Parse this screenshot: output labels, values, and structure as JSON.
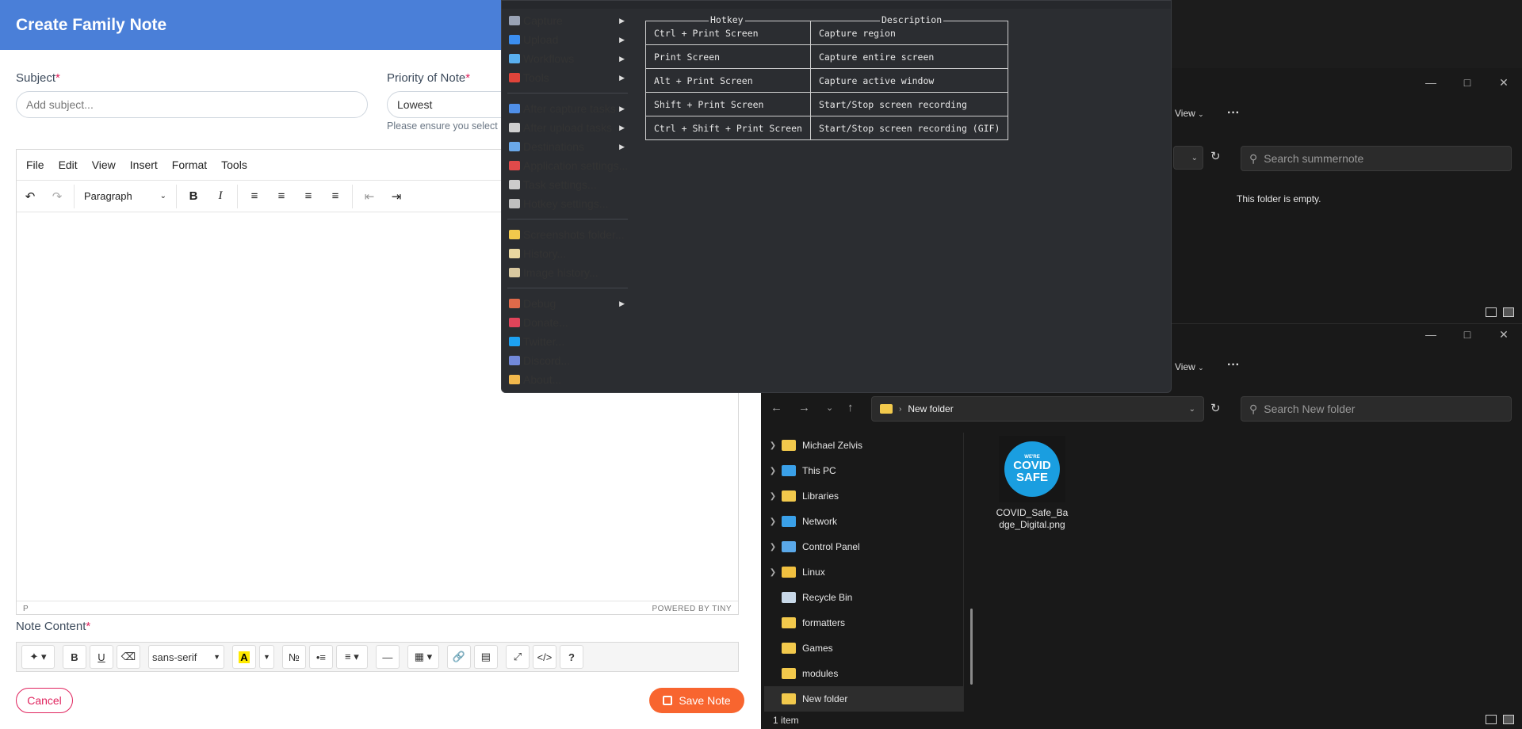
{
  "modal": {
    "title": "Create Family Note",
    "subject_label": "Subject",
    "subject_placeholder": "Add subject...",
    "priority_label": "Priority of Note",
    "priority_value": "Lowest",
    "priority_hint": "Please ensure you select",
    "required_mark": "*",
    "editor_menu": [
      "File",
      "Edit",
      "View",
      "Insert",
      "Format",
      "Tools"
    ],
    "block_format": "Paragraph",
    "status_path": "P",
    "powered_by": "POWERED BY TINY",
    "note_content_label": "Note Content",
    "font_name": "sans-serif",
    "cancel_label": "Cancel",
    "save_label": "Save Note"
  },
  "sharex": {
    "menu_items": [
      {
        "label": "Capture",
        "submenu": true,
        "color": "#9aa3b5"
      },
      {
        "label": "Upload",
        "submenu": true,
        "color": "#3b8ef0"
      },
      {
        "label": "Workflows",
        "submenu": true,
        "color": "#5ab0f0"
      },
      {
        "label": "Tools",
        "submenu": true,
        "color": "#e0443a"
      },
      {
        "label": "After capture tasks",
        "submenu": true,
        "color": "#4f8fe8",
        "sep_before": true
      },
      {
        "label": "After upload tasks",
        "submenu": true,
        "color": "#cfcfcf"
      },
      {
        "label": "Destinations",
        "submenu": true,
        "color": "#6aa8e8"
      },
      {
        "label": "Application settings...",
        "submenu": false,
        "color": "#e04a4a"
      },
      {
        "label": "Task settings...",
        "submenu": false,
        "color": "#cccccc"
      },
      {
        "label": "Hotkey settings...",
        "submenu": false,
        "color": "#bfbfbf"
      },
      {
        "label": "Screenshots folder...",
        "submenu": false,
        "color": "#f2c94c",
        "sep_before": true
      },
      {
        "label": "History...",
        "submenu": false,
        "color": "#e8d6a0"
      },
      {
        "label": "Image history...",
        "submenu": false,
        "color": "#d8c8a0"
      },
      {
        "label": "Debug",
        "submenu": true,
        "color": "#e06a4a",
        "sep_before": true
      },
      {
        "label": "Donate...",
        "submenu": false,
        "color": "#e0445a"
      },
      {
        "label": "Twitter...",
        "submenu": false,
        "color": "#1da1f2"
      },
      {
        "label": "Discord...",
        "submenu": false,
        "color": "#7289da"
      },
      {
        "label": "About...",
        "submenu": false,
        "color": "#f2b84c"
      }
    ],
    "hotkey_header": "Hotkey",
    "description_header": "Description",
    "hotkeys": [
      {
        "key": "Ctrl + Print Screen",
        "desc": "Capture region"
      },
      {
        "key": "Print Screen",
        "desc": "Capture entire screen"
      },
      {
        "key": "Alt + Print Screen",
        "desc": "Capture active window"
      },
      {
        "key": "Shift + Print Screen",
        "desc": "Start/Stop screen recording"
      },
      {
        "key": "Ctrl + Shift + Print Screen",
        "desc": "Start/Stop screen recording (GIF)"
      }
    ]
  },
  "explorer1": {
    "view_label": "View",
    "search_placeholder": "Search summernote",
    "empty_text": "This folder is empty."
  },
  "explorer2": {
    "view_label": "View",
    "breadcrumb": "New folder",
    "search_placeholder": "Search New folder",
    "tree": [
      {
        "label": "Michael Zelvis",
        "expandable": true,
        "icon": "folder-icon"
      },
      {
        "label": "This PC",
        "expandable": true,
        "icon": "pc-icon"
      },
      {
        "label": "Libraries",
        "expandable": true,
        "icon": "folder-icon"
      },
      {
        "label": "Network",
        "expandable": true,
        "icon": "network-icon"
      },
      {
        "label": "Control Panel",
        "expandable": true,
        "icon": "control-panel-icon"
      },
      {
        "label": "Linux",
        "expandable": true,
        "icon": "linux-icon"
      },
      {
        "label": "Recycle Bin",
        "expandable": false,
        "icon": "recycle-bin-icon"
      },
      {
        "label": "formatters",
        "expandable": false,
        "icon": "folder-icon"
      },
      {
        "label": "Games",
        "expandable": false,
        "icon": "folder-icon"
      },
      {
        "label": "modules",
        "expandable": false,
        "icon": "folder-icon"
      },
      {
        "label": "New folder",
        "expandable": false,
        "icon": "folder-icon",
        "selected": true
      }
    ],
    "file_name": "COVID_Safe_Badge_Digital.png",
    "badge_line1": "WE'RE",
    "badge_line2": "COVID",
    "badge_line3": "SAFE",
    "status": "1 item"
  },
  "colors": {
    "modal_header": "#4a7fd8",
    "save_button": "#f8652f",
    "cancel_border": "#e0245e",
    "badge_blue": "#1a9ee0"
  }
}
